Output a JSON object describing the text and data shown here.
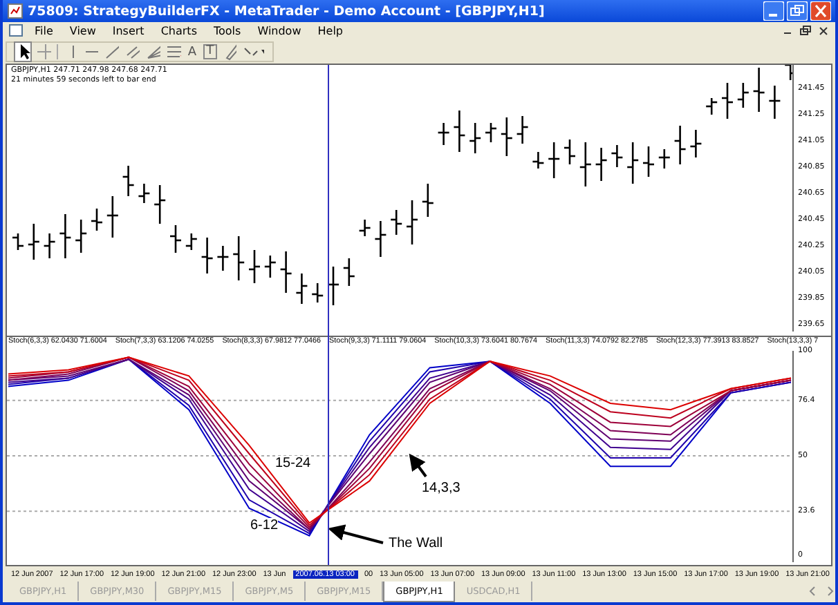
{
  "window": {
    "title": "75809: StrategyBuilderFX - MetaTrader - Demo Account - [GBPJPY,H1]"
  },
  "menu": [
    "File",
    "View",
    "Insert",
    "Charts",
    "Tools",
    "Window",
    "Help"
  ],
  "toolbar_glyphs": [
    "A",
    "T"
  ],
  "chart": {
    "info_line": "GBPJPY,H1  247.71 247.98 247.68 247.71",
    "timer": "21 minutes 59 seconds left to bar end",
    "price_axis": [
      "241.45",
      "241.25",
      "241.05",
      "240.85",
      "240.65",
      "240.45",
      "240.25",
      "240.05",
      "239.85",
      "239.65"
    ],
    "stoch_legend_values": [
      "62.0430 71.6004",
      "63.1206 74.0255",
      "67.9812 77.0466",
      "71.1111 79.0604",
      "73.6041 80.7674",
      "74.0792 82.2785",
      "77.3913 83.8527",
      "7"
    ],
    "chart_data": {
      "type": "line",
      "ylim": [
        0,
        100
      ],
      "yticks": [
        0,
        23.6,
        50,
        76.4,
        100
      ],
      "grid": true,
      "series": [
        {
          "name": "Stoch(6,3,3)",
          "color": "#0000c8",
          "values": [
            83,
            86,
            96,
            72,
            25,
            12,
            60,
            92,
            95,
            75,
            45,
            45,
            80,
            85
          ]
        },
        {
          "name": "Stoch(7,3,3)",
          "color": "#1f00ab",
          "values": [
            84,
            87,
            96,
            74,
            29,
            13,
            57,
            90,
            95,
            77,
            49,
            49,
            80,
            85
          ]
        },
        {
          "name": "Stoch(8,3,3)",
          "color": "#3f008f",
          "values": [
            85,
            87,
            96,
            77,
            34,
            14,
            54,
            87,
            95,
            79,
            54,
            53,
            81,
            86
          ]
        },
        {
          "name": "Stoch(9,3,3)",
          "color": "#5e0072",
          "values": [
            86,
            88,
            96,
            79,
            38,
            15,
            51,
            85,
            95,
            81,
            58,
            57,
            81,
            86
          ]
        },
        {
          "name": "Stoch(10,3,3)",
          "color": "#7e0056",
          "values": [
            86,
            89,
            97,
            81,
            42,
            15,
            47,
            82,
            95,
            82,
            62,
            60,
            81,
            86
          ]
        },
        {
          "name": "Stoch(11,3,3)",
          "color": "#9d0039",
          "values": [
            87,
            90,
            97,
            83,
            46,
            16,
            44,
            80,
            95,
            84,
            66,
            64,
            81,
            86
          ]
        },
        {
          "name": "Stoch(12,3,3)",
          "color": "#bd001d",
          "values": [
            88,
            90,
            97,
            86,
            51,
            17,
            41,
            77,
            95,
            86,
            71,
            68,
            82,
            87
          ]
        },
        {
          "name": "Stoch(13,3,3)",
          "color": "#dc0000",
          "values": [
            89,
            91,
            97,
            88,
            55,
            18,
            38,
            75,
            95,
            88,
            75,
            72,
            82,
            87
          ]
        }
      ]
    },
    "annotations": [
      "15-24",
      "6-12",
      "14,3,3",
      "The Wall"
    ],
    "x_axis": [
      "12 Jun 2007",
      "12 Jun 17:00",
      "12 Jun 19:00",
      "12 Jun 21:00",
      "12 Jun 23:00",
      "13 Jun",
      "00",
      "13 Jun 05:00",
      "13 Jun 07:00",
      "13 Jun 09:00",
      "13 Jun 11:00",
      "13 Jun 13:00",
      "13 Jun 15:00",
      "13 Jun 17:00",
      "13 Jun 19:00",
      "13 Jun 21:00"
    ],
    "cursor_label": "2007.06.13 03:00"
  },
  "tabs": [
    {
      "label": "GBPJPY,H1",
      "selected": false
    },
    {
      "label": "GBPJPY,M30",
      "selected": false
    },
    {
      "label": "GBPJPY,M15",
      "selected": false
    },
    {
      "label": "GBPJPY,M5",
      "selected": false
    },
    {
      "label": "GBPJPY,M15",
      "selected": false
    },
    {
      "label": "GBPJPY,H1",
      "selected": true
    },
    {
      "label": "USDCAD,H1",
      "selected": false
    }
  ]
}
